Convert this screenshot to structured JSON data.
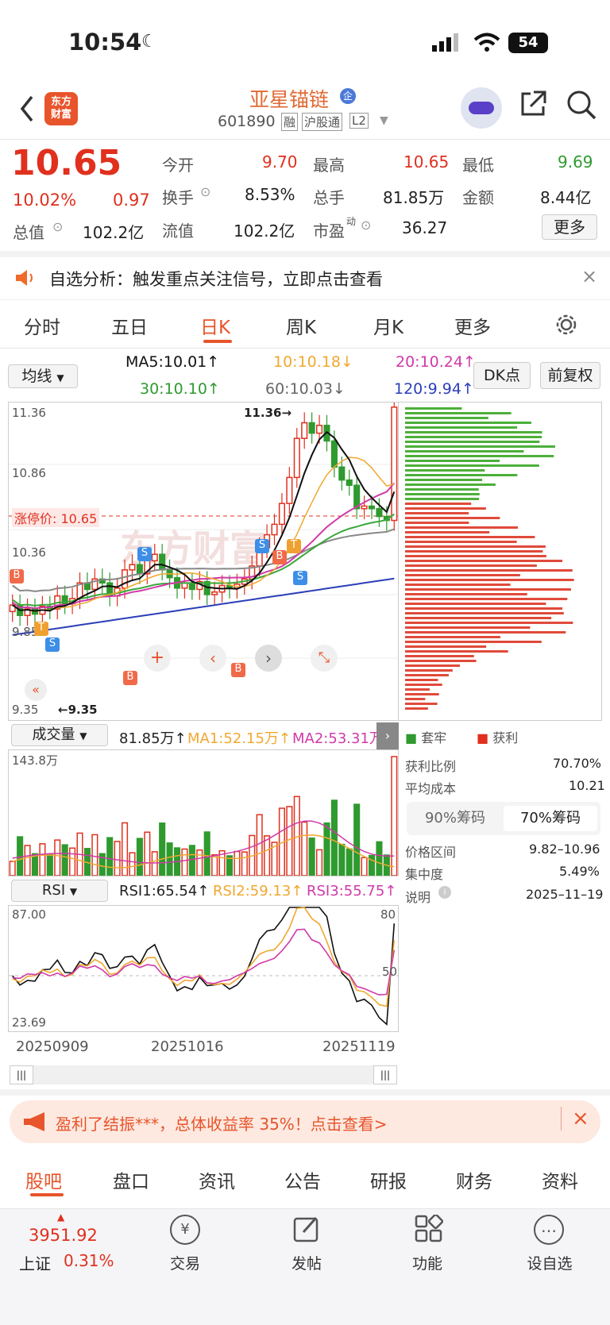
{
  "status": {
    "time": "10:54",
    "battery": "54"
  },
  "header": {
    "logo_line1": "东方",
    "logo_line2": "财富",
    "stock_name": "亚星锚链",
    "code": "601890",
    "tag1": "融",
    "tag2": "沪股通",
    "tag3": "L2"
  },
  "quote": {
    "price": "10.65",
    "pct": "10.02%",
    "chg": "0.97",
    "open_label": "今开",
    "open": "9.70",
    "high_label": "最高",
    "high": "10.65",
    "low_label": "最低",
    "low": "9.69",
    "turn_label": "换手",
    "turn": "8.53%",
    "vol_label": "总手",
    "vol": "81.85万",
    "amt_label": "金额",
    "amt": "8.44亿",
    "mcap_label": "总值",
    "mcap": "102.2亿",
    "float_label": "流值",
    "float": "102.2亿",
    "pe_label": "市盈",
    "pe_sup": "动",
    "pe": "36.27",
    "more": "更多"
  },
  "notice": {
    "text": "自选分析：触发重点关注信号，立即点击查看"
  },
  "tabs": [
    "分时",
    "五日",
    "日K",
    "周K",
    "月K",
    "更多"
  ],
  "ma": {
    "selector": "均线",
    "ma5": "MA5:10.01↑",
    "ma10": "10:10.18↓",
    "ma20": "20:10.24↑",
    "ma30": "30:10.10↑",
    "ma60": "60:10.03↓",
    "ma120": "120:9.94↑",
    "dk": "DK点",
    "fq": "前复权"
  },
  "kline": {
    "y1": "11.36",
    "y2": "10.86",
    "y3": "10.36",
    "y4": "9.85",
    "y5": "9.35",
    "high_mark": "11.36→",
    "low_mark": "←9.35",
    "limit": "涨停价: 10.65",
    "watermark": "东方财富"
  },
  "colors": {
    "up": "#e0301e",
    "down": "#2f9a2f",
    "ma5": "#111111",
    "ma10": "#f0a830",
    "ma20": "#d03aa8",
    "ma30": "#3aa83a",
    "ma60": "#888888",
    "ma120": "#2c3fb8"
  },
  "volume": {
    "selector": "成交量",
    "val": "81.85万↑",
    "ma1": "MA1:52.15万↑",
    "ma2": "MA2:53.31万",
    "ymax": "143.8万"
  },
  "rsi": {
    "selector": "RSI",
    "r1": "RSI1:65.54↑",
    "r2": "RSI2:59.13↑",
    "r3": "RSI3:55.75↑",
    "top": "87.00",
    "bottom": "23.69",
    "r80": "80",
    "r50": "50"
  },
  "dates": {
    "d1": "20250909",
    "d2": "20251016",
    "d3": "20251119"
  },
  "chip": {
    "legend1": "套牢",
    "legend2": "获利",
    "profit_ratio_label": "获利比例",
    "profit_ratio": "70.70%",
    "avg_cost_label": "平均成本",
    "avg_cost": "10.21",
    "tab90": "90%筹码",
    "tab70": "70%筹码",
    "range_label": "价格区间",
    "range": "9.82–10.96",
    "conc_label": "集中度",
    "conc": "5.49%",
    "note_label": "说明",
    "note_date": "2025–11–19"
  },
  "ad": {
    "text": "盈利了结振***，总体收益率 35%！点击查看>"
  },
  "ftabs": [
    "股吧",
    "盘口",
    "资讯",
    "公告",
    "研报",
    "财务",
    "资料"
  ],
  "bottom": {
    "index_val": "3951.92",
    "index_name": "上证",
    "index_pct": "0.31%",
    "nav": [
      "交易",
      "发帖",
      "功能",
      "设自选"
    ]
  }
}
